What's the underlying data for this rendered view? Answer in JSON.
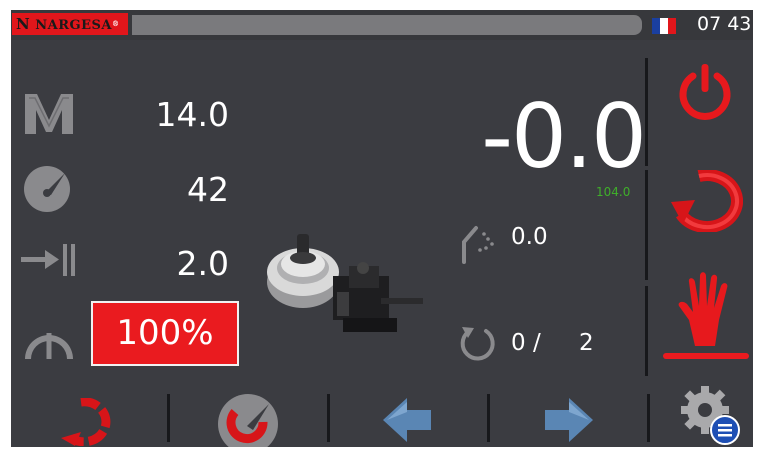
{
  "header": {
    "logo_text": "NARGESA",
    "clock": "07 43",
    "language_flag": "france-flag-icon"
  },
  "left_params": [
    {
      "icon": "mold-m-icon",
      "value": "14.0"
    },
    {
      "icon": "speed-dial-icon",
      "value": "42"
    },
    {
      "icon": "offset-arrow-icon",
      "value": "2.0"
    },
    {
      "icon": "pressure-gauge-icon",
      "value": "100%"
    }
  ],
  "main_display": {
    "angle": "-0.0",
    "reference": "104.0",
    "springback_value": "0.0",
    "cycles": "0 /",
    "cycles_total": "2"
  },
  "right_buttons": [
    "power-icon",
    "rotation-icon",
    "manual-hand-icon"
  ],
  "bottom_buttons": [
    "return-rotation-icon",
    "bend-dial-icon",
    "arrow-left-icon",
    "arrow-right-icon",
    "settings-list-icon"
  ],
  "colors": {
    "screen_bg": "#3b3c41",
    "accent_red": "#ea1b1f",
    "green": "#3fae2a",
    "arrow_blue": "#5a86b4",
    "icon_grey": "#8a8a8d"
  }
}
